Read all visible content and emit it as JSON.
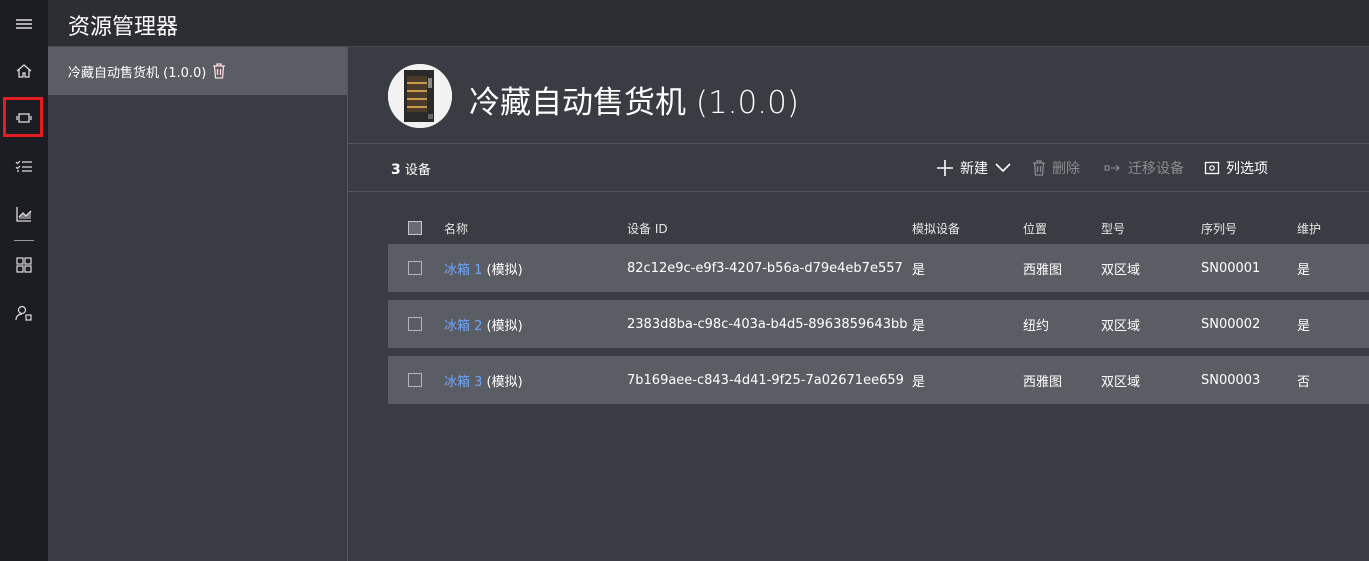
{
  "app": {
    "title": "资源管理器"
  },
  "rail": {
    "icons": [
      "menu-icon",
      "home-icon",
      "devices-icon",
      "jobs-icon",
      "analytics-icon",
      "dashboard-icon",
      "admin-icon"
    ]
  },
  "left_panel": {
    "template_label": "冷藏自动售货机 (1.0.0)"
  },
  "header": {
    "title": "冷藏自动售货机 (1.0.0)"
  },
  "toolbar": {
    "count_number": "3",
    "count_label": "设备",
    "new_label": "新建",
    "delete_label": "删除",
    "migrate_label": "迁移设备",
    "columns_label": "列选项"
  },
  "table": {
    "columns": [
      "名称",
      "设备 ID",
      "模拟设备",
      "位置",
      "型号",
      "序列号",
      "维护"
    ],
    "rows": [
      {
        "name_link": "冰箱 1",
        "name_suffix": "(模拟)",
        "id": "82c12e9c-e9f3-4207-b56a-d79e4eb7e557",
        "simulated": "是",
        "location": "西雅图",
        "model": "双区域",
        "serial": "SN00001",
        "maintenance": "是"
      },
      {
        "name_link": "冰箱 2",
        "name_suffix": "(模拟)",
        "id": "2383d8ba-c98c-403a-b4d5-8963859643bb",
        "simulated": "是",
        "location": "纽约",
        "model": "双区域",
        "serial": "SN00002",
        "maintenance": "是"
      },
      {
        "name_link": "冰箱 3",
        "name_suffix": "(模拟)",
        "id": "7b169aee-c843-4d41-9f25-7a02671ee659",
        "simulated": "是",
        "location": "西雅图",
        "model": "双区域",
        "serial": "SN00003",
        "maintenance": "否"
      }
    ]
  },
  "colors": {
    "accent_link": "#6aa6ff",
    "highlight_box": "#e21d24",
    "rail_bg": "#1c1d22",
    "row_bg": "#5b5d64"
  }
}
